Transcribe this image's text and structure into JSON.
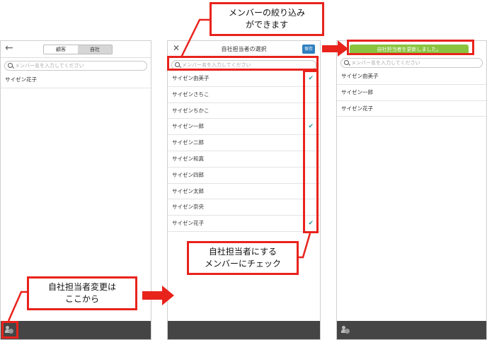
{
  "panel1": {
    "back_icon": "arrow-left-icon",
    "segments": [
      "顧客",
      "自社"
    ],
    "search_placeholder": "メンバー名を入力してください",
    "members": [
      "サイゼン花子"
    ]
  },
  "panel2": {
    "close_icon": "close-icon",
    "title": "自社担当者の選択",
    "save_label": "保存",
    "search_placeholder": "メンバー名を入力してください",
    "members": [
      {
        "name": "サイゼン由美子",
        "checked": true
      },
      {
        "name": "サイゼンさちこ",
        "checked": false
      },
      {
        "name": "サイゼンちかこ",
        "checked": false
      },
      {
        "name": "サイゼン一郎",
        "checked": true
      },
      {
        "name": "サイゼン二郎",
        "checked": false
      },
      {
        "name": "サイゼン和真",
        "checked": false
      },
      {
        "name": "サイゼン四郎",
        "checked": false
      },
      {
        "name": "サイゼン太郎",
        "checked": false
      },
      {
        "name": "サイゼン奈央",
        "checked": false
      },
      {
        "name": "サイゼン花子",
        "checked": true
      }
    ],
    "check_glyph": "✔"
  },
  "panel3": {
    "toast": "自社担当者を更新しました。",
    "search_placeholder": "メンバー名を入力してください",
    "members": [
      "サイゼン由美子",
      "サイゼン一郎",
      "サイゼン花子"
    ]
  },
  "annotations": {
    "filter_note": "メンバーの絞り込み\nができます",
    "check_note": "自社担当者にする\nメンバーにチェック",
    "change_note": "自社担当者変更は\nここから"
  },
  "colors": {
    "accent_red": "#e8231c",
    "save_blue": "#2f7fbf",
    "toast_green": "#8ac43f",
    "check_teal": "#2a9aa3",
    "footer_dark": "#454545"
  }
}
